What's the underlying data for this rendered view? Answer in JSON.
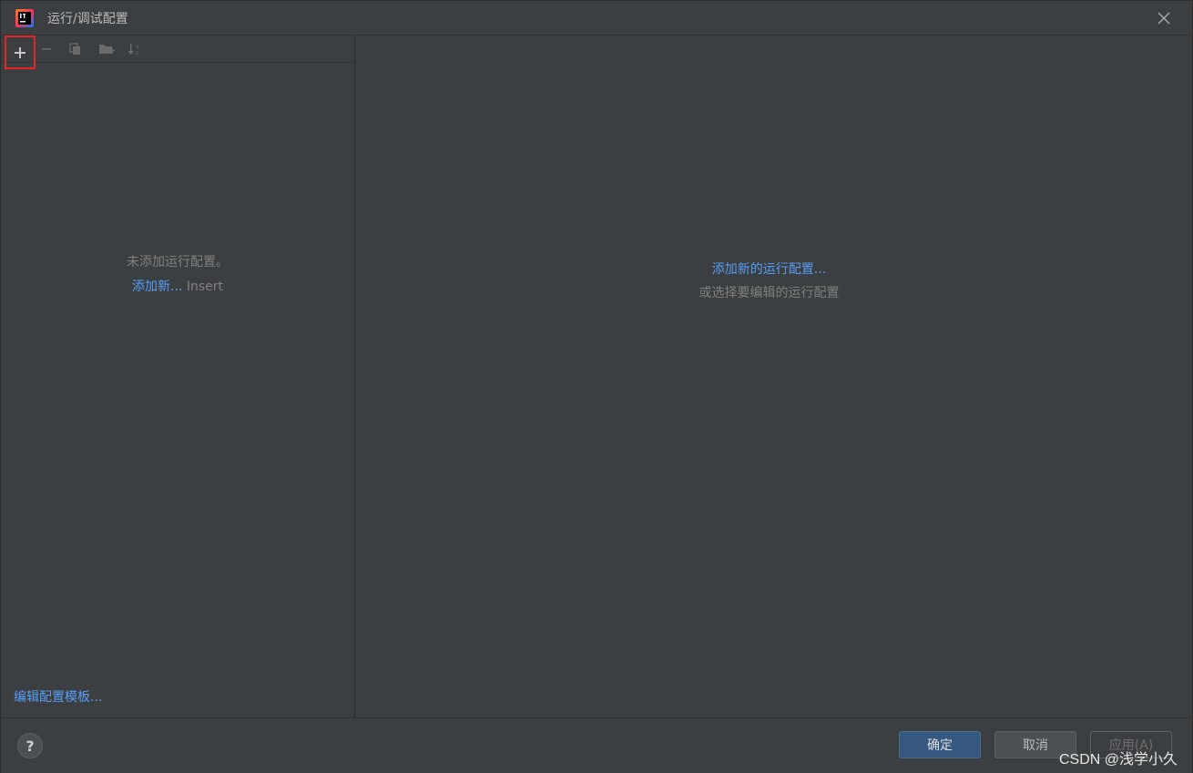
{
  "window": {
    "title": "运行/调试配置"
  },
  "left": {
    "empty_message": "未添加运行配置。",
    "add_new_link": "添加新...",
    "add_new_shortcut": "Insert",
    "edit_templates_link": "编辑配置模板..."
  },
  "right": {
    "add_config_link": "添加新的运行配置...",
    "select_hint": "或选择要编辑的运行配置"
  },
  "footer": {
    "help_label": "?",
    "ok_label": "确定",
    "cancel_label": "取消",
    "apply_label": "应用(A)",
    "watermark": "CSDN @浅学小久"
  },
  "colors": {
    "background": "#3c3f41",
    "link": "#589df6",
    "highlight_box": "#e8261f",
    "ok_button": "#365880"
  }
}
